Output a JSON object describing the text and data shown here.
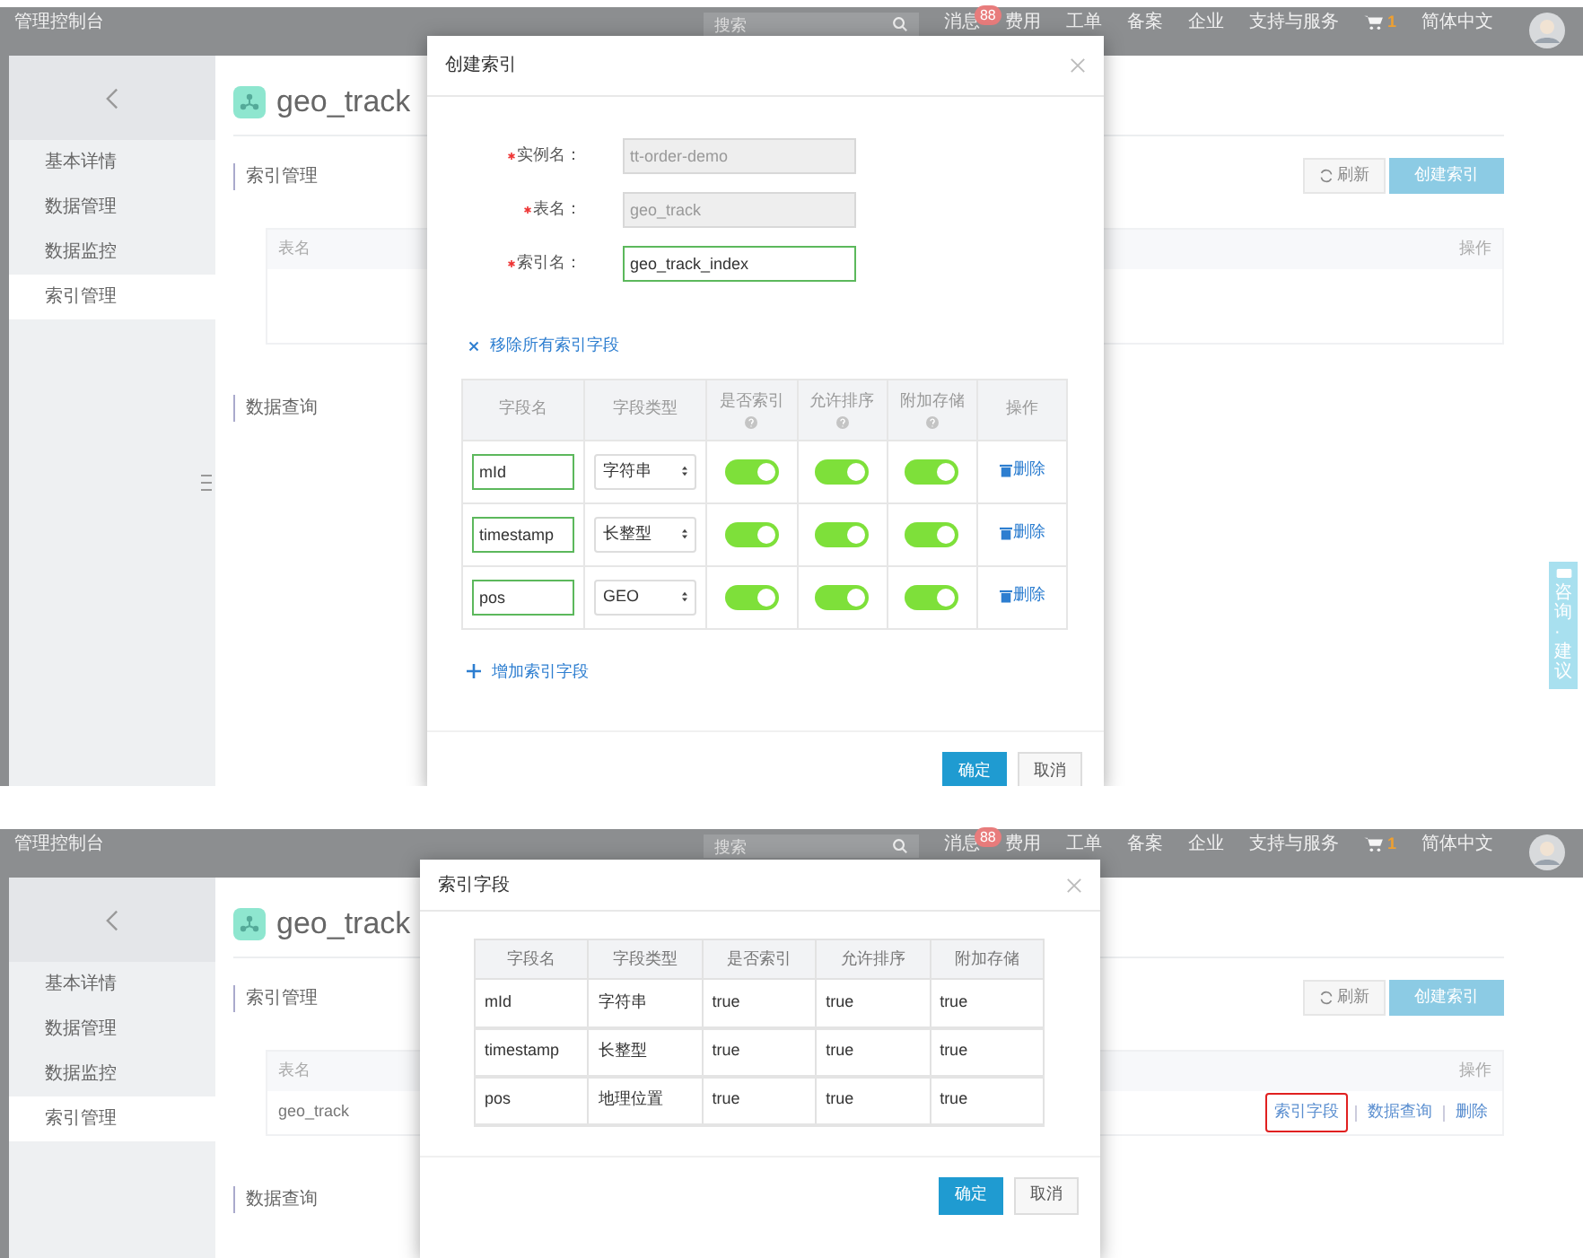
{
  "screens": [
    {
      "header": {
        "title": "管理控制台",
        "search_placeholder": "搜索",
        "nav": [
          {
            "label": "消息",
            "badge": "88"
          },
          {
            "label": "费用"
          },
          {
            "label": "工单"
          },
          {
            "label": "备案"
          },
          {
            "label": "企业"
          },
          {
            "label": "支持与服务"
          }
        ],
        "cart_count": "1",
        "language": "简体中文"
      },
      "sidebar": {
        "items": [
          {
            "label": "基本详情",
            "selected": false
          },
          {
            "label": "数据管理",
            "selected": false
          },
          {
            "label": "数据监控",
            "selected": false
          },
          {
            "label": "索引管理",
            "selected": true
          }
        ]
      },
      "page": {
        "title": "geo_track",
        "index_heading": "索引管理",
        "refresh_button": "刷新",
        "create_button": "创建索引",
        "columns": [
          "表名",
          "操作"
        ],
        "query_heading": "数据查询"
      },
      "feedback_tab": "咨询·建议",
      "modal": {
        "kind": "create_index",
        "title": "创建索引",
        "form": [
          {
            "label": "实例名：",
            "value": "tt-order-demo",
            "required": true,
            "disabled": true
          },
          {
            "label": "表名：",
            "value": "geo_track",
            "required": true,
            "disabled": true
          },
          {
            "label": "索引名：",
            "value": "geo_track_index",
            "required": true,
            "disabled": false
          }
        ],
        "remove_all_link": "移除所有索引字段",
        "columns": [
          "字段名",
          "字段类型",
          "是否索引",
          "允许排序",
          "附加存储",
          "操作"
        ],
        "fields": [
          {
            "name": "mId",
            "type": "字符串",
            "indexed": true,
            "sortable": true,
            "stored": true,
            "action": "删除"
          },
          {
            "name": "timestamp",
            "type": "长整型",
            "indexed": true,
            "sortable": true,
            "stored": true,
            "action": "删除"
          },
          {
            "name": "pos",
            "type": "GEO",
            "indexed": true,
            "sortable": true,
            "stored": true,
            "action": "删除"
          }
        ],
        "add_link": "增加索引字段",
        "ok_button": "确定",
        "cancel_button": "取消"
      }
    },
    {
      "header": {
        "title": "管理控制台",
        "search_placeholder": "搜索",
        "nav": [
          {
            "label": "消息",
            "badge": "88"
          },
          {
            "label": "费用"
          },
          {
            "label": "工单"
          },
          {
            "label": "备案"
          },
          {
            "label": "企业"
          },
          {
            "label": "支持与服务"
          }
        ],
        "cart_count": "1",
        "language": "简体中文"
      },
      "sidebar": {
        "items": [
          {
            "label": "基本详情",
            "selected": false
          },
          {
            "label": "数据管理",
            "selected": false
          },
          {
            "label": "数据监控",
            "selected": false
          },
          {
            "label": "索引管理",
            "selected": true
          }
        ]
      },
      "page": {
        "title": "geo_track",
        "index_heading": "索引管理",
        "refresh_button": "刷新",
        "create_button": "创建索引",
        "columns": [
          "表名",
          "操作"
        ],
        "rows": [
          {
            "table_name": "geo_track",
            "actions": [
              {
                "label": "索引字段",
                "highlighted": true
              },
              {
                "label": "数据查询",
                "highlighted": false
              },
              {
                "label": "删除",
                "highlighted": false
              }
            ]
          }
        ],
        "query_heading": "数据查询"
      },
      "modal": {
        "kind": "field_list",
        "title": "索引字段",
        "columns": [
          "字段名",
          "字段类型",
          "是否索引",
          "允许排序",
          "附加存储"
        ],
        "rows": [
          [
            "mId",
            "字符串",
            "true",
            "true",
            "true"
          ],
          [
            "timestamp",
            "长整型",
            "true",
            "true",
            "true"
          ],
          [
            "pos",
            "地理位置",
            "true",
            "true",
            "true"
          ]
        ],
        "ok_button": "确定",
        "cancel_button": "取消"
      }
    }
  ]
}
